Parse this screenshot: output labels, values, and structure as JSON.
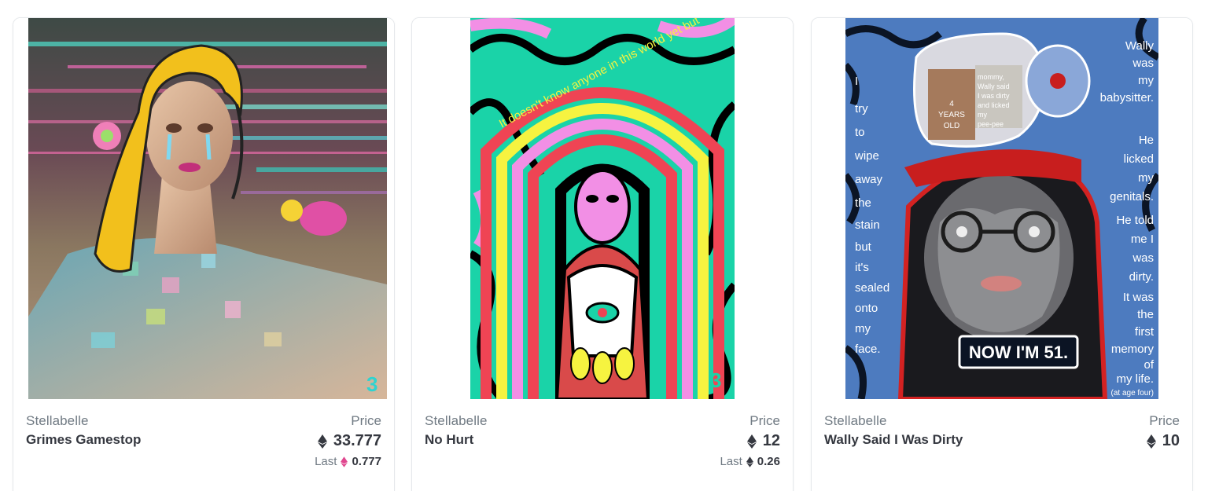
{
  "cards": [
    {
      "collection": "Stellabelle",
      "title": "Grimes Gamestop",
      "price_label": "Price",
      "price": "33.777",
      "currency_icon": "eth-icon",
      "last_label": "Last",
      "last_price": "0.777",
      "last_currency_icon": "weth-icon",
      "last_currency_color": "#e0478f"
    },
    {
      "collection": "Stellabelle",
      "title": "No Hurt",
      "price_label": "Price",
      "price": "12",
      "currency_icon": "eth-icon",
      "last_label": "Last",
      "last_price": "0.26",
      "last_currency_icon": "eth-icon",
      "last_currency_color": "#353840"
    },
    {
      "collection": "Stellabelle",
      "title": "Wally Said I Was Dirty",
      "price_label": "Price",
      "price": "10",
      "currency_icon": "eth-icon"
    }
  ],
  "artwork3": {
    "left_text": [
      "I",
      "try",
      "to",
      "wipe",
      "away",
      "the",
      "stain",
      "but",
      "it's",
      "sealed",
      "onto",
      "my",
      "face."
    ],
    "right_text": [
      "Wally",
      "was",
      "my",
      "babysitter.",
      "He",
      "licked",
      "my",
      "genitals.",
      "He told",
      "me I",
      "was",
      "dirty.",
      "It was",
      "the",
      "first",
      "memory",
      "of",
      "my life."
    ],
    "footnote": "(at age four)",
    "banner": "NOW I'M 51.",
    "speech": [
      "mommy,",
      "Wally said",
      "I was dirty",
      "and licked",
      "my",
      "pee-pee"
    ],
    "dress_text": [
      "4",
      "YEARS",
      "OLD"
    ]
  },
  "artwork2": {
    "arc_text": "It doesn't know anyone in this world yet but"
  },
  "colors": {
    "text_primary": "#353840",
    "text_secondary": "#707a83",
    "border": "#e5e8eb"
  }
}
